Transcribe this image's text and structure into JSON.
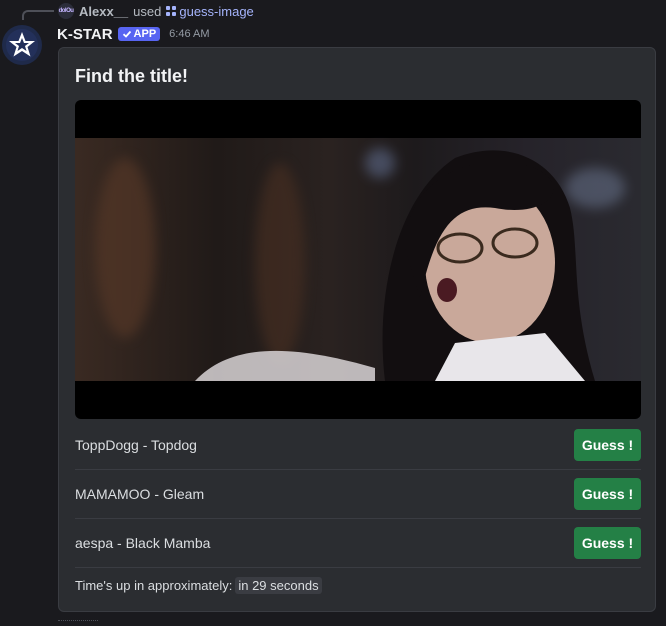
{
  "reply": {
    "avatar_text": "dolOu",
    "user": "Alexx__",
    "used_text": "used",
    "command": "guess-image"
  },
  "message": {
    "bot_name": "K-STAR",
    "badge": "APP",
    "timestamp": "6:46 AM"
  },
  "embed": {
    "title": "Find the title!",
    "choices": [
      {
        "label": "ToppDogg - Topdog",
        "button": "Guess !"
      },
      {
        "label": "MAMAMOO - Gleam",
        "button": "Guess !"
      },
      {
        "label": "aespa - Black Mamba",
        "button": "Guess !"
      }
    ],
    "footer_text": "Time's up in approximately:",
    "timer_text": "in 29 seconds"
  },
  "colors": {
    "background": "#1a1a1e",
    "embed_bg": "#2b2d31",
    "button_green": "#248046",
    "badge_blurple": "#5865f2"
  },
  "icons": [
    "bot-star-avatar-icon",
    "slash-command-icon",
    "verified-check-icon"
  ]
}
